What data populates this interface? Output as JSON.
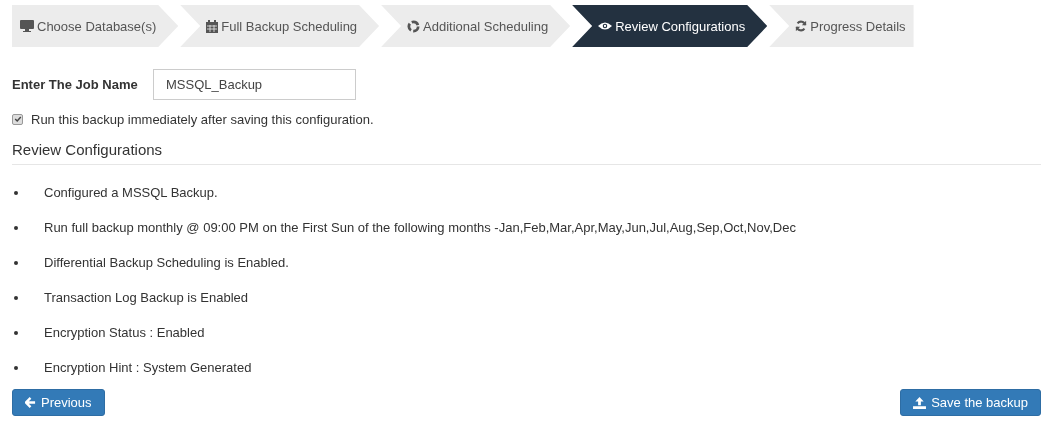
{
  "steps": [
    {
      "label": "Choose Database(s)",
      "selected": false
    },
    {
      "label": "Full Backup Scheduling",
      "selected": false
    },
    {
      "label": "Additional Scheduling",
      "selected": false
    },
    {
      "label": "Review Configurations",
      "selected": true
    },
    {
      "label": "Progress Details",
      "selected": false
    }
  ],
  "job_name": {
    "label": "Enter The Job Name",
    "value": "MSSQL_Backup"
  },
  "run_immediately": {
    "label": "Run this backup immediately after saving this configuration.",
    "checked": true
  },
  "review": {
    "heading": "Review Configurations",
    "items": [
      "Configured a MSSQL Backup.",
      "Run full backup monthly @ 09:00 PM on the First Sun of the following months -Jan,Feb,Mar,Apr,May,Jun,Jul,Aug,Sep,Oct,Nov,Dec",
      "Differential Backup Scheduling is Enabled.",
      "Transaction Log Backup is Enabled",
      "Encryption Status : Enabled",
      "Encryption Hint : System Generated"
    ]
  },
  "buttons": [
    {
      "label": "Previous",
      "kind": "back"
    },
    {
      "label": "Save the backup",
      "kind": "save"
    }
  ]
}
